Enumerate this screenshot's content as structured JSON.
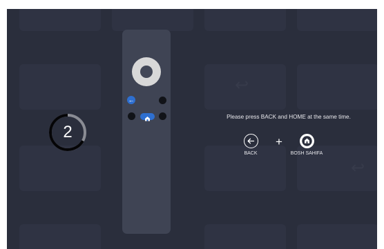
{
  "colors": {
    "background": "#2a2e3c",
    "remote_body": "#3f4454",
    "accent_blue": "#2e6fd0",
    "text": "#e8e8ec"
  },
  "countdown": {
    "value": "2",
    "progress_fraction": 0.67
  },
  "instruction": {
    "text": "Please press BACK and HOME at the same time."
  },
  "keys": {
    "back": {
      "label": "BACK",
      "icon": "arrow-left-icon"
    },
    "plus": "+",
    "home": {
      "label": "BOSH SAHIFA",
      "icon": "home-icon"
    }
  },
  "remote": {
    "highlighted_keys": [
      "back",
      "home"
    ]
  }
}
